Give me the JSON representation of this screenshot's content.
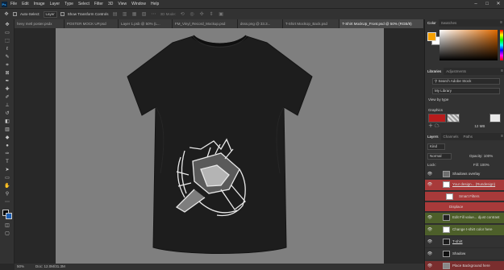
{
  "menubar": {
    "logo": "Ps",
    "items": [
      "File",
      "Edit",
      "Image",
      "Layer",
      "Type",
      "Select",
      "Filter",
      "3D",
      "View",
      "Window",
      "Help"
    ]
  },
  "options_bar": {
    "auto_select_label": "Auto-Select:",
    "auto_select_value": "Layer",
    "show_transform_label": "Show Transform Controls",
    "mode_label": "3D Mode:"
  },
  "tabs": [
    "hevy metl poster.psdx",
    "POSTER MOCK UP.psd",
    "Layer 1.psb @ 50% (L...",
    "FM_Vinyl_Record_Mockup.psd",
    "dsss.png @ 33.3...",
    "T-Shirt MockUp_Back.psd",
    "T-Shirt MockUp_Front.psd @ 50% (RGB/8)"
  ],
  "active_tab_index": 6,
  "status": {
    "zoom": "50%",
    "doc": "Doc: 12.0M/31.3M"
  },
  "color_panel": {
    "tabs": [
      "Color",
      "Swatches"
    ],
    "foreground": "#f5a000",
    "background": "#ffffff"
  },
  "libraries_panel": {
    "tabs": [
      "Libraries",
      "Adjustments"
    ],
    "search_placeholder": "Search Adobe Stock",
    "library_name": "My Library",
    "view_by": "View by type",
    "section": "Graphics",
    "size": "12 MB"
  },
  "layers_panel": {
    "tabs": [
      "Layers",
      "Channels",
      "Paths"
    ],
    "kind": "Kind",
    "blend": "Normal",
    "opacity": "Opacity: 100%",
    "lock": "Lock:",
    "fill": "Fill: 100%",
    "layers": [
      {
        "name": "Shadows overlay",
        "style": "normal"
      },
      {
        "name": "Your design... (Rundesign)",
        "style": "red"
      },
      {
        "name": "Smart Filters",
        "style": "red"
      },
      {
        "name": "Displace",
        "style": "red"
      },
      {
        "name": "Edit Fill value... djust contrast",
        "style": "olive"
      },
      {
        "name": "Change t-shirt color here",
        "style": "olive"
      },
      {
        "name": "T-shirt",
        "style": "normal"
      },
      {
        "name": "Shadow",
        "style": "normal"
      },
      {
        "name": "Place Background here",
        "style": "selected"
      }
    ]
  },
  "icons": {
    "eye": "eye-icon",
    "minimize": "minimize-icon",
    "maximize": "maximize-icon",
    "close": "close-icon"
  }
}
